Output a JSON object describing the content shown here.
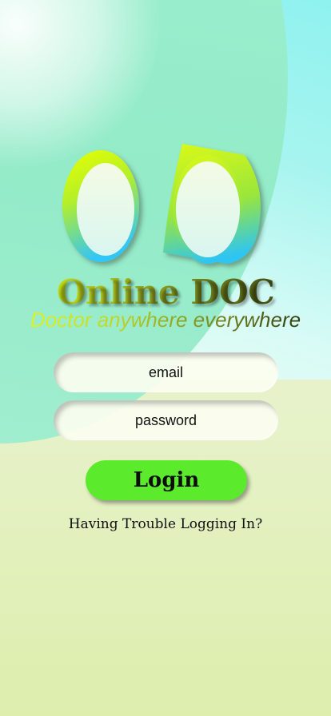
{
  "app": {
    "title": "Online DOC",
    "tagline": "Doctor anywhere everywhere"
  },
  "form": {
    "email_placeholder": "email",
    "password_placeholder": "password",
    "login_label": "Login",
    "trouble_label": "Having Trouble Logging In?"
  },
  "colors": {
    "login_button": "#5cea2c",
    "logo_ring_top": "#e4ff00",
    "logo_ring_bottom": "#38c8f5",
    "background_cyan": "#8ff2ef",
    "background_green": "#9aeecd",
    "background_lower": "#e7f2cb"
  },
  "logo": {
    "icon": "double-o-logo"
  }
}
